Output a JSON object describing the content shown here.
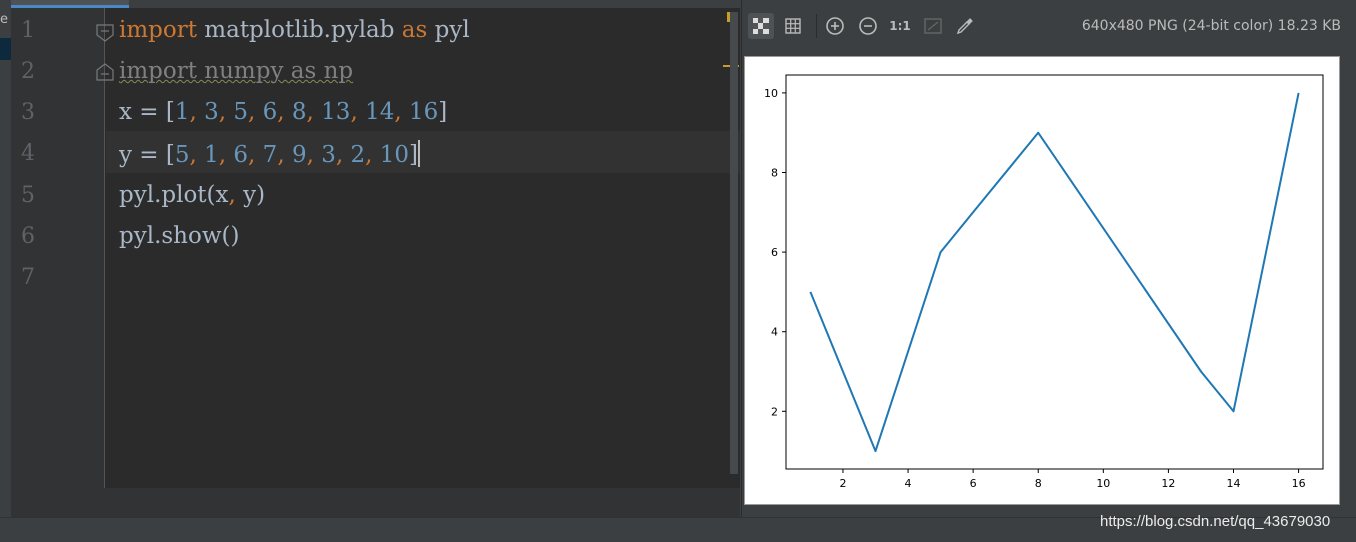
{
  "sidebar": {
    "fragment": "e"
  },
  "editor": {
    "line_numbers": [
      "1",
      "2",
      "3",
      "4",
      "5",
      "6",
      "7"
    ],
    "lines": {
      "l1": {
        "kw1": "import",
        "mod": " matplotlib.pylab ",
        "kw2": "as",
        "alias": " pyl"
      },
      "l2": {
        "text": "import numpy as np"
      },
      "l3": {
        "prefix": "x = [",
        "nums": [
          "1",
          "3",
          "5",
          "6",
          "8",
          "13",
          "14",
          "16"
        ],
        "suffix": "]"
      },
      "l4": {
        "prefix": "y = [",
        "nums": [
          "5",
          "1",
          "6",
          "7",
          "9",
          "3",
          "2",
          "10"
        ],
        "suffix": "]"
      },
      "l5": {
        "fn": "pyl.plot(x",
        "comma": ",",
        "rest": " y)"
      },
      "l6": {
        "text": "pyl.show()"
      }
    }
  },
  "viewer": {
    "image_info": "640x480 PNG (24-bit color) 18.23 KB",
    "toolbar": [
      "chessboard-icon",
      "grid-icon",
      "zoom-in-icon",
      "zoom-out-icon",
      "actual-size-icon",
      "fit-icon",
      "color-picker-icon"
    ],
    "actual_size_label": "1:1"
  },
  "chart_data": {
    "type": "line",
    "x": [
      1,
      3,
      5,
      6,
      8,
      13,
      14,
      16
    ],
    "series": [
      {
        "values": [
          5,
          1,
          6,
          7,
          9,
          3,
          2,
          10
        ]
      }
    ],
    "xticks": [
      2,
      4,
      6,
      8,
      10,
      12,
      14,
      16
    ],
    "yticks": [
      2,
      4,
      6,
      8,
      10
    ],
    "xlim": [
      0.25,
      16.75
    ],
    "ylim": [
      0.55,
      10.45
    ],
    "color": "#1f77b4",
    "title": "",
    "xlabel": "",
    "ylabel": ""
  },
  "watermark": "https://blog.csdn.net/qq_43679030"
}
